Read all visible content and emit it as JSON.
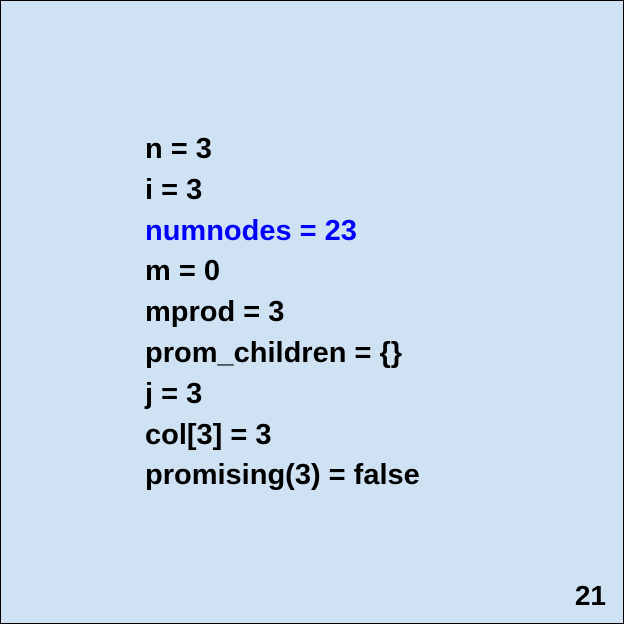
{
  "colors": {
    "background": "#cfe2f3",
    "text": "#000000",
    "highlight": "#0000ff"
  },
  "variables": [
    {
      "text": "n = 3",
      "highlight": false
    },
    {
      "text": "i = 3",
      "highlight": false
    },
    {
      "text": "numnodes = 23",
      "highlight": true
    },
    {
      "text": "m = 0",
      "highlight": false
    },
    {
      "text": "mprod = 3",
      "highlight": false
    },
    {
      "text": "prom_children = {}",
      "highlight": false
    },
    {
      "text": "j = 3",
      "highlight": false
    },
    {
      "text": "col[3] = 3",
      "highlight": false
    },
    {
      "text": "promising(3) = false",
      "highlight": false
    }
  ],
  "page_number": "21"
}
